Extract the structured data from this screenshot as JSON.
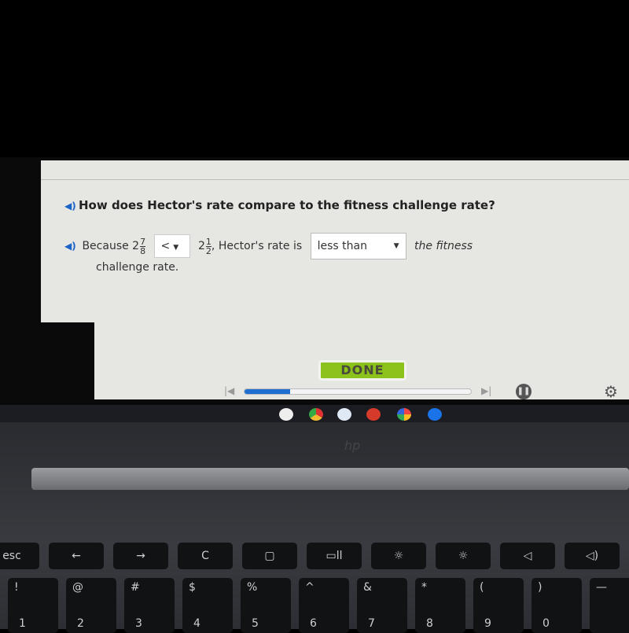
{
  "question": {
    "text": "How does Hector's rate compare to the fitness challenge rate?",
    "speaker_icon": "speaker-icon"
  },
  "sentence": {
    "prefix": "Because 2",
    "frac1_num": "7",
    "frac1_den": "8",
    "comparison_selected": "<",
    "whole2": "2",
    "frac2_num": "1",
    "frac2_den": "2",
    "middle": ", Hector's rate is",
    "relation_selected": "less than",
    "suffix": "the fitness",
    "line2": "challenge rate."
  },
  "done_label": "DONE",
  "progress": {
    "percent": 20,
    "accent": "#1f6fd0"
  },
  "dock": [
    "gmail",
    "chrome",
    "docs",
    "youtube",
    "photos",
    "files"
  ],
  "keyboard": {
    "fn_row": [
      "esc",
      "←",
      "→",
      "C",
      "▢",
      "▭ll",
      "☼",
      "☼",
      "◁",
      "◁)"
    ],
    "num_row": [
      [
        "!",
        "1"
      ],
      [
        "@",
        "2"
      ],
      [
        "#",
        "3"
      ],
      [
        "$",
        "4"
      ],
      [
        "%",
        "5"
      ],
      [
        "^",
        "6"
      ],
      [
        "&",
        "7"
      ],
      [
        "*",
        "8"
      ],
      [
        "(",
        "9"
      ],
      [
        ")",
        "0"
      ],
      [
        "—",
        ""
      ]
    ]
  },
  "brand": "hp"
}
